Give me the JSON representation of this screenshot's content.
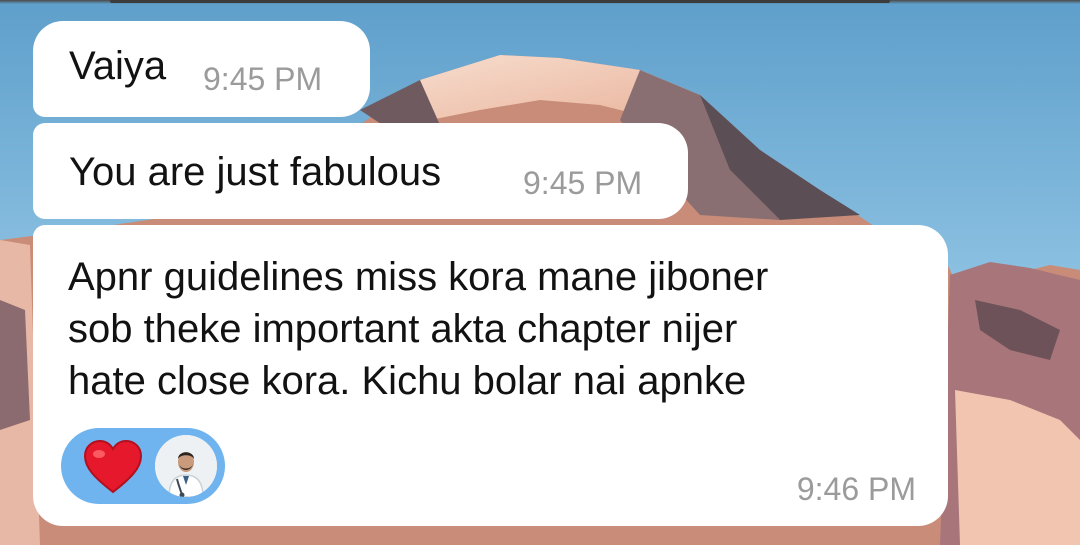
{
  "messages": [
    {
      "text": "Vaiya",
      "time": "9:45 PM"
    },
    {
      "text": "You are just fabulous",
      "time": "9:45 PM"
    },
    {
      "text": "Apnr guidelines miss kora mane jiboner\nsob theke important akta chapter nijer\nhate close kora. Kichu bolar nai apnke",
      "time": "9:46 PM",
      "reaction": {
        "emoji_icon": "heart-icon",
        "color": "#e5192b",
        "reactor": "avatar"
      }
    }
  ],
  "colors": {
    "bubble": "#ffffff",
    "timestamp": "#9b9b9b",
    "reaction_pill": "#6fb4ee",
    "sky": "#6fa9d2"
  }
}
